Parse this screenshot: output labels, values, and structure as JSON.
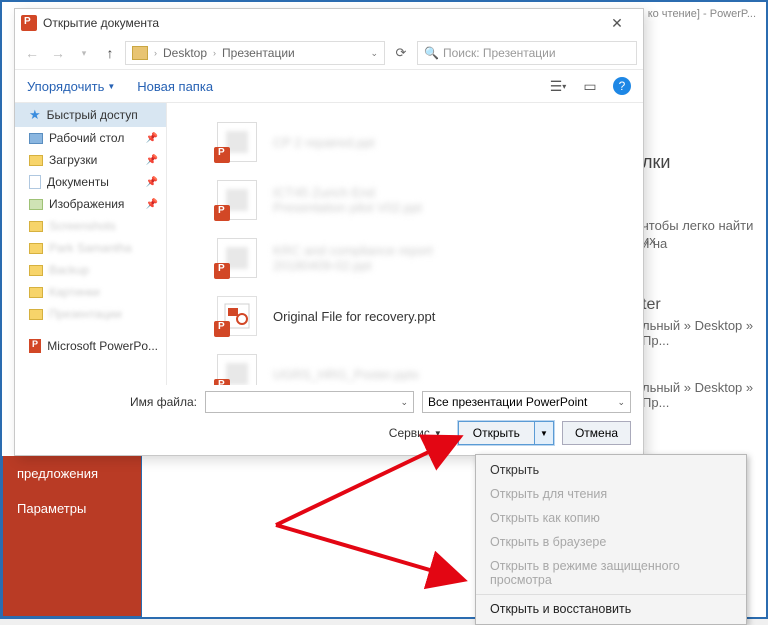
{
  "bg": {
    "title_suffix": "ко чтение]  -  PowerP...",
    "heading1": "лки",
    "text1a": "чтобы легко найти их",
    "text1b": "и на",
    "heading2": "ter",
    "path1": "льный » Desktop » Пр...",
    "path2": "льный » Desktop » Пр...",
    "nav1": "предложения",
    "nav2": "Параметры"
  },
  "dialog": {
    "title": "Открытие документа",
    "breadcrumb": {
      "seg1": "Desktop",
      "seg2": "Презентации"
    },
    "search_placeholder": "Поиск: Презентации",
    "toolbar": {
      "organize": "Упорядочить",
      "newfolder": "Новая папка"
    },
    "sidebar": {
      "quick": "Быстрый доступ",
      "desktop": "Рабочий стол",
      "downloads": "Загрузки",
      "documents": "Документы",
      "pictures": "Изображения",
      "s1": "Screenshots",
      "s2": "Park Samantha",
      "s3": "Backup",
      "s4": "Картинки",
      "s5": "Презентации",
      "pp": "Microsoft PowerPo..."
    },
    "files": {
      "f1": "CP 2 repaired.ppt",
      "f2a": "ICT45 Zurich End",
      "f2b": "Presentation pilot V02.ppt",
      "f3a": "KRC and compliance report",
      "f3b": "20180409-02.ppt",
      "f4": "Original File for recovery.ppt",
      "f5": "UGRS_HRG_Poster.pptx"
    },
    "filename_label": "Имя файла:",
    "filter": "Все презентации PowerPoint",
    "tools": "Сервис",
    "open": "Открыть",
    "cancel": "Отмена"
  },
  "menu": {
    "m1": "Открыть",
    "m2": "Открыть для чтения",
    "m3": "Открыть как копию",
    "m4": "Открыть в браузере",
    "m5": "Открыть в режиме защищенного просмотра",
    "m6": "Открыть и восстановить"
  }
}
